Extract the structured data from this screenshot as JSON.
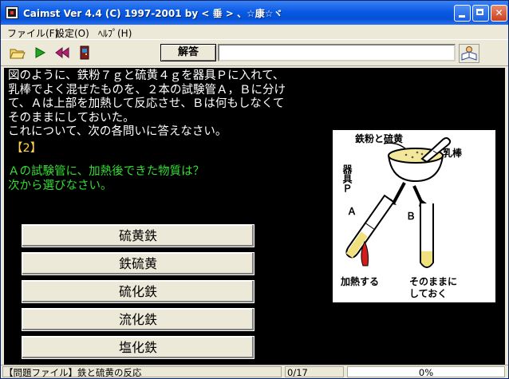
{
  "window": {
    "title": "Caimst Ver 4.4 (C) 1997-2001  by < 垂 > 、☆康☆ヾ"
  },
  "menu": {
    "file": "ファイル(F)",
    "settings": "設定(O)",
    "help": "ﾍﾙﾌﾟ(H)"
  },
  "toolbar": {
    "open_icon": "folder-open-icon",
    "play_icon": "play-icon",
    "rewind_icon": "rewind-icon",
    "stop_icon": "exit-icon",
    "answer_label": "解答",
    "answer_value": "",
    "help_icon": "book-icon"
  },
  "question": {
    "text": "図のように、鉄粉７ｇと硫黄４ｇを器具Ｐに入れて、\n乳棒でよく混ぜたものを、２本の試験管Ａ，Ｂに分け\nて、Ａは上部を加熱して反応させ、Ｂは何もしなくて\nそのままにしておいた。\nこれについて、次の各問いに答えなさい。",
    "number": "【2】",
    "sub": "Ａの試験管に、加熱後できた物質は？\n次から選びなさい。"
  },
  "choices": [
    "硫黄鉄",
    "鉄硫黄",
    "硫化鉄",
    "流化鉄",
    "塩化鉄"
  ],
  "figure": {
    "top_label": "鉄粉と硫黄",
    "pestle_label": "乳棒",
    "vessel_label": "器具Ｐ",
    "tube_a": "Ａ",
    "tube_b": "Ｂ",
    "caption_a": "加熱する",
    "caption_b_1": "そのままに",
    "caption_b_2": "しておく"
  },
  "status": {
    "file": "【問題ファイル】鉄と硫黄の反応",
    "count": "0/17",
    "progress_text": "0%",
    "progress": 0
  },
  "colors": {
    "titlebar": "#0a5ae6",
    "question_text": "#ffffff",
    "number_text": "#ffd24d",
    "sub_text": "#33dd33",
    "background": "#000000"
  }
}
